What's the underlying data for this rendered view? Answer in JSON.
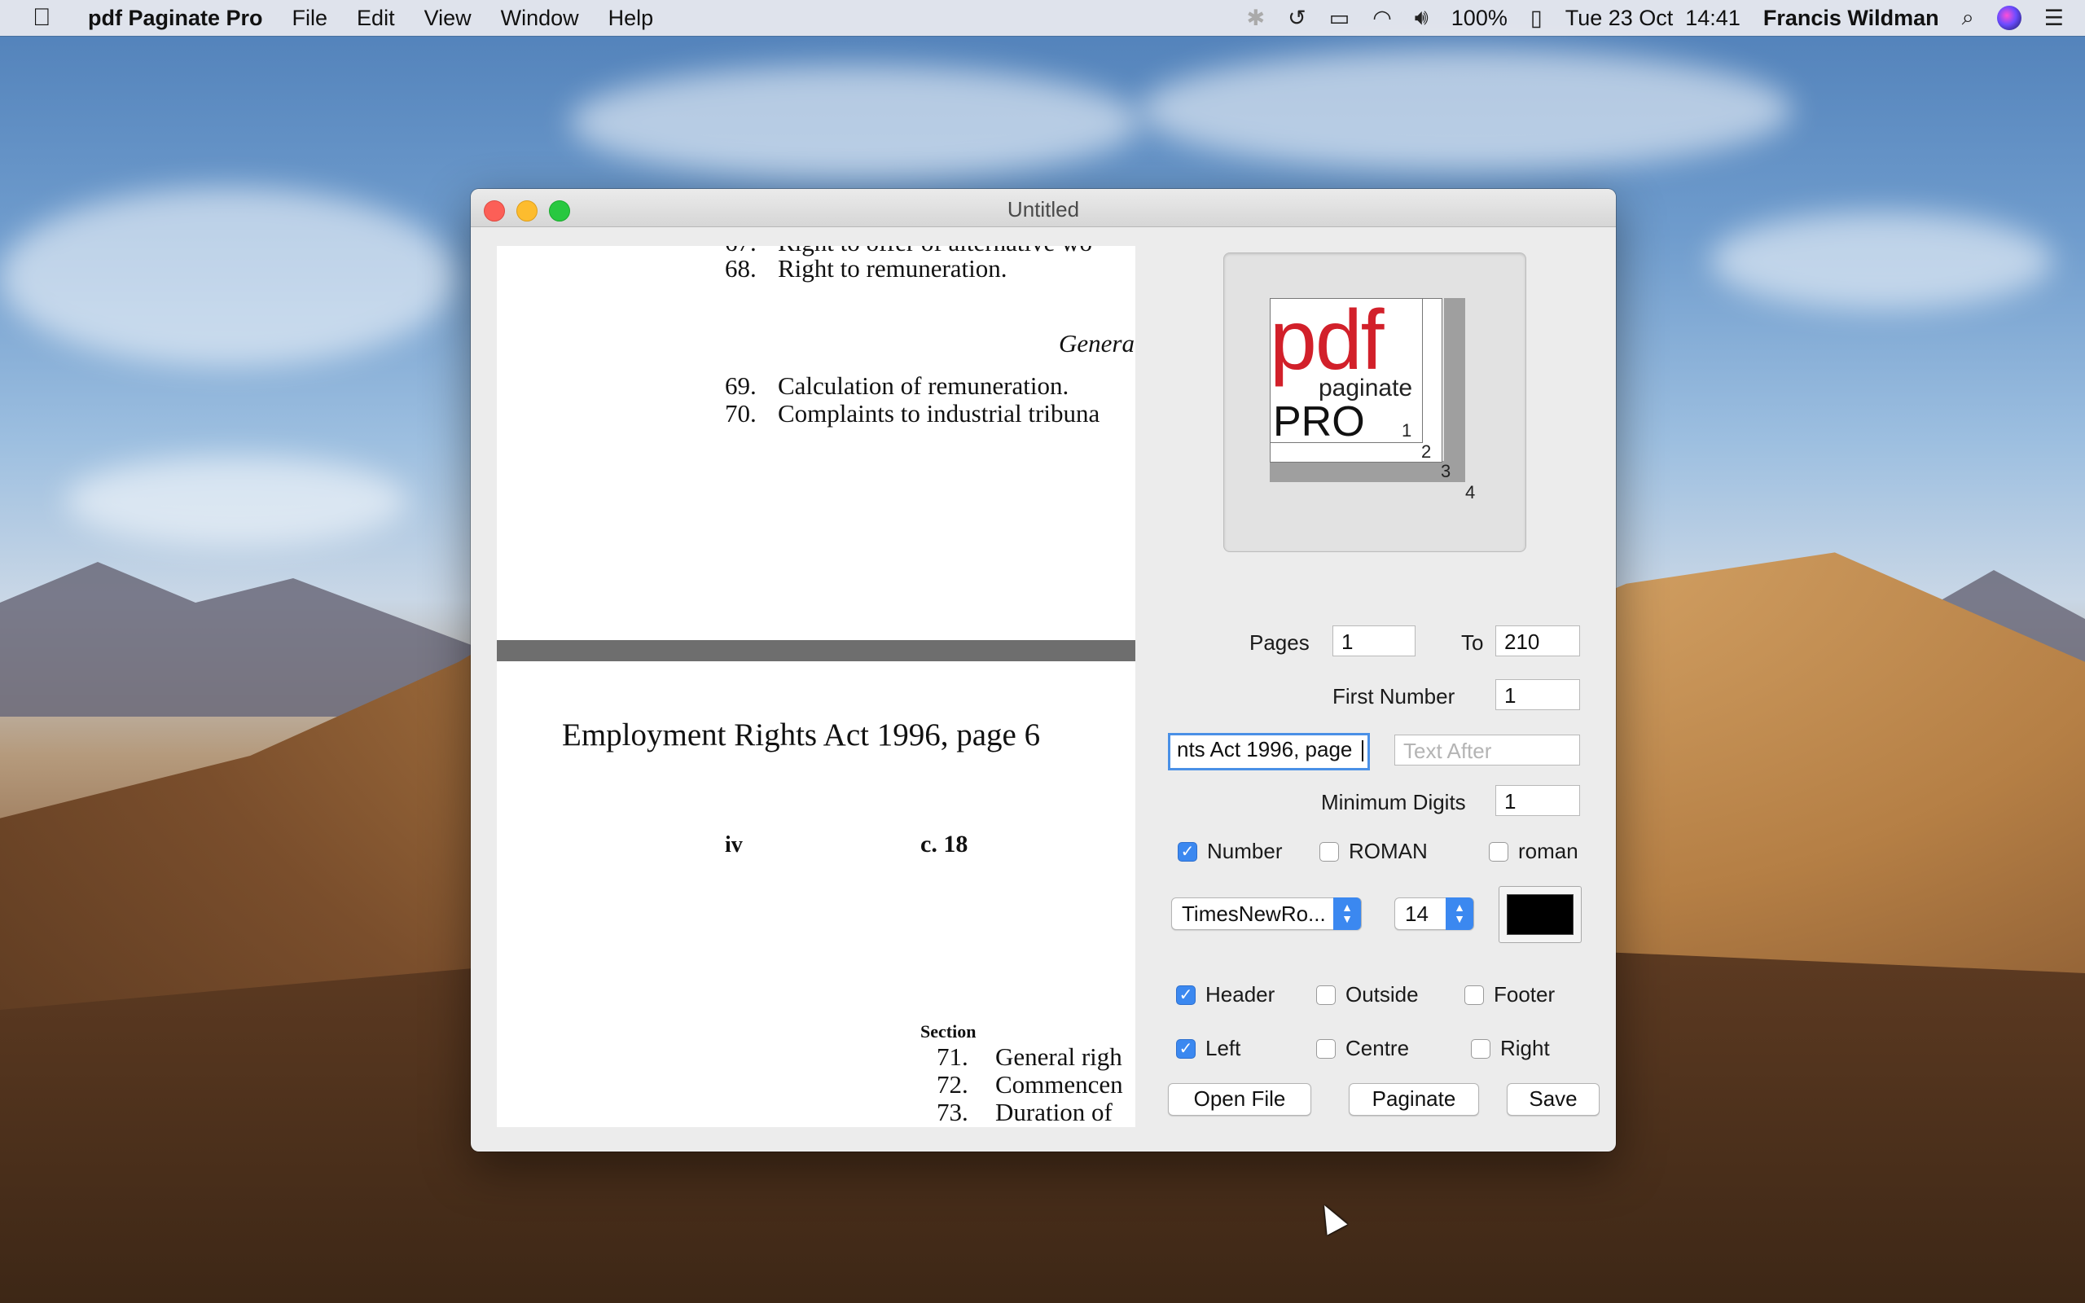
{
  "menubar": {
    "app_name": "pdf Paginate Pro",
    "menus": [
      "File",
      "Edit",
      "View",
      "Window",
      "Help"
    ],
    "battery": "100%",
    "datetime": "Tue 23 Oct  14:41",
    "user": "Francis Wildman"
  },
  "window": {
    "title": "Untitled"
  },
  "preview": {
    "lines_top": [
      {
        "num": "68.",
        "text": "Right to remuneration."
      },
      {
        "heading": "Genera"
      },
      {
        "num": "69.",
        "text": "Calculation of remuneration."
      },
      {
        "num": "70.",
        "text": "Complaints to industrial tribuna"
      }
    ],
    "header_text": "Employment Rights Act 1996, page 6",
    "page_left": "iv",
    "page_chapter": "c. 18",
    "section_label": "Section",
    "lines_bottom": [
      {
        "num": "71.",
        "text": "General righ"
      },
      {
        "num": "72.",
        "text": "Commencen"
      },
      {
        "num": "73.",
        "text": "Duration of"
      }
    ]
  },
  "logo": {
    "pdf": "pdf",
    "paginate": "paginate",
    "pro": "PRO",
    "n1": "1",
    "n2": "2",
    "n3": "3",
    "n4": "4"
  },
  "form": {
    "pages_label": "Pages",
    "pages_from": "1",
    "to_label": "To",
    "pages_to": "210",
    "first_number_label": "First Number",
    "first_number": "1",
    "text_before": "nts Act 1996, page ",
    "text_after_placeholder": "Text After",
    "min_digits_label": "Minimum Digits",
    "min_digits": "1",
    "format": {
      "number": {
        "label": "Number",
        "checked": true
      },
      "roman_upper": {
        "label": "ROMAN",
        "checked": false
      },
      "roman_lower": {
        "label": "roman",
        "checked": false
      }
    },
    "font": "TimesNewRo...",
    "font_size": "14",
    "color": "#000000",
    "position_v": {
      "header": {
        "label": "Header",
        "checked": true
      },
      "outside": {
        "label": "Outside",
        "checked": false
      },
      "footer": {
        "label": "Footer",
        "checked": false
      }
    },
    "position_h": {
      "left": {
        "label": "Left",
        "checked": true
      },
      "centre": {
        "label": "Centre",
        "checked": false
      },
      "right": {
        "label": "Right",
        "checked": false
      }
    },
    "buttons": {
      "open": "Open File",
      "paginate": "Paginate",
      "save": "Save"
    }
  }
}
